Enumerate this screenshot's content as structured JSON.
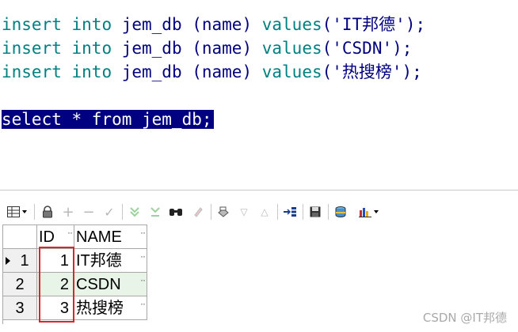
{
  "editor": {
    "lines": [
      {
        "kw1": "insert",
        "sp1": " ",
        "kw2": "into",
        "mid": " jem_db (name) ",
        "kw3": "values",
        "str": "('IT邦德');"
      },
      {
        "kw1": "insert",
        "sp1": " ",
        "kw2": "into",
        "mid": " jem_db (name) ",
        "kw3": "values",
        "str": "('CSDN');"
      },
      {
        "kw1": "insert",
        "sp1": " ",
        "kw2": "into",
        "mid": " jem_db (name) ",
        "kw3": "values",
        "str": "('热搜榜');"
      }
    ],
    "selected_query": "select * from jem_db;"
  },
  "toolbar": {
    "icons": [
      "grid-menu-icon",
      "lock-icon",
      "add-record-icon",
      "delete-record-icon",
      "post-edit-icon",
      "query-by-example-icon",
      "clear-filter-icon",
      "find-icon",
      "clear-icon",
      "print-icon",
      "sort-descending-icon",
      "sort-ascending-icon",
      "export-icon",
      "save-icon",
      "database-icon",
      "chart-icon"
    ]
  },
  "grid": {
    "columns": [
      "ID",
      "NAME"
    ],
    "rows": [
      {
        "num": "1",
        "id": "1",
        "name": "IT邦德"
      },
      {
        "num": "2",
        "id": "2",
        "name": "CSDN"
      },
      {
        "num": "3",
        "id": "3",
        "name": "热搜榜"
      }
    ],
    "highlight_color": "#d9262b"
  },
  "watermark": "CSDN @IT邦德"
}
